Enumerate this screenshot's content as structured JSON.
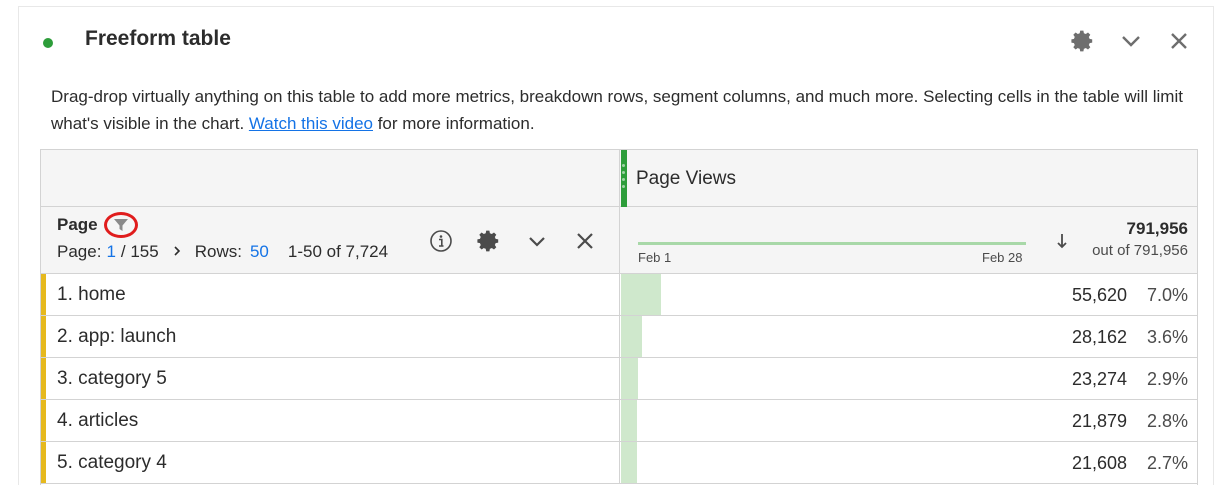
{
  "panel": {
    "title": "Freeform table",
    "status_color": "#2d9d3a",
    "header_icons": [
      "gear-icon",
      "chevron-down-icon",
      "close-icon"
    ]
  },
  "description": {
    "text_before": "Drag-drop virtually anything on this table to add more metrics, breakdown rows, segment columns, and much more. Selecting cells in the table will limit what's visible in the chart. ",
    "link_text": "Watch this video",
    "text_after": " for more information."
  },
  "table": {
    "metric_label": "Page Views",
    "dimension": {
      "title": "Page",
      "page_label": "Page:",
      "page_current": "1",
      "page_total": "/ 155",
      "rows_label": "Rows:",
      "rows_value": "50",
      "range": "1-50 of 7,724"
    },
    "sparkline": {
      "start": "Feb 1",
      "end": "Feb 28"
    },
    "total": "791,956",
    "total_sub": "out of 791,956",
    "rows": [
      {
        "name": "1.  home",
        "value": "55,620",
        "pct": "7.0%",
        "share": 0.07
      },
      {
        "name": "2.  app: launch",
        "value": "28,162",
        "pct": "3.6%",
        "share": 0.036
      },
      {
        "name": "3.  category 5",
        "value": "23,274",
        "pct": "2.9%",
        "share": 0.029
      },
      {
        "name": "4.  articles",
        "value": "21,879",
        "pct": "2.8%",
        "share": 0.028
      },
      {
        "name": "5.  category 4",
        "value": "21,608",
        "pct": "2.7%",
        "share": 0.027
      }
    ]
  }
}
